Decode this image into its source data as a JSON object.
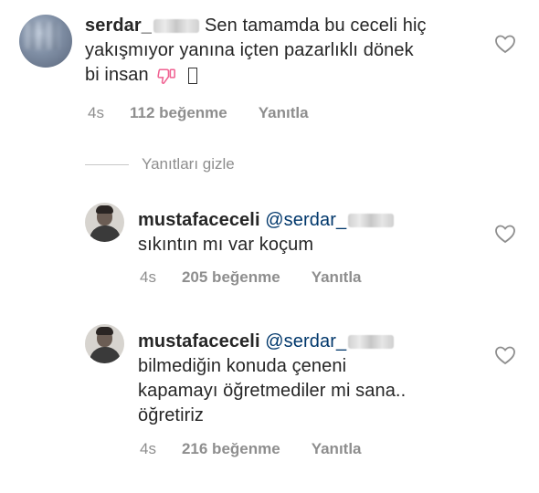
{
  "comments": [
    {
      "username": "serdar_",
      "text_line1": "Sen tamamda bu ceceli hiç",
      "text_line2": "yakışmıyor yanına içten pazarlıklı dönek",
      "text_line3": "bi insan",
      "time": "4s",
      "likes": "112 beğenme",
      "reply": "Yanıtla"
    },
    {
      "username": "mustafaceceli",
      "mention": "@serdar_",
      "text_line1": "sıkıntın mı var koçum",
      "time": "4s",
      "likes": "205 beğenme",
      "reply": "Yanıtla"
    },
    {
      "username": "mustafaceceli",
      "mention": "@serdar_",
      "text_line1": "bilmediğin konuda çeneni",
      "text_line2": "kapamayı öğretmediler mi sana..",
      "text_line3": "öğretiriz",
      "time": "4s",
      "likes": "216 beğenme",
      "reply": "Yanıtla"
    }
  ],
  "hide_replies_label": "Yanıtları gizle",
  "icons": {
    "like": "heart-outline-icon",
    "thumbs_down_emoji": "thumbs-down-emoji"
  },
  "colors": {
    "text": "#262626",
    "meta": "#8e8e8e",
    "mention": "#00376b",
    "emoji": "#f06292"
  }
}
